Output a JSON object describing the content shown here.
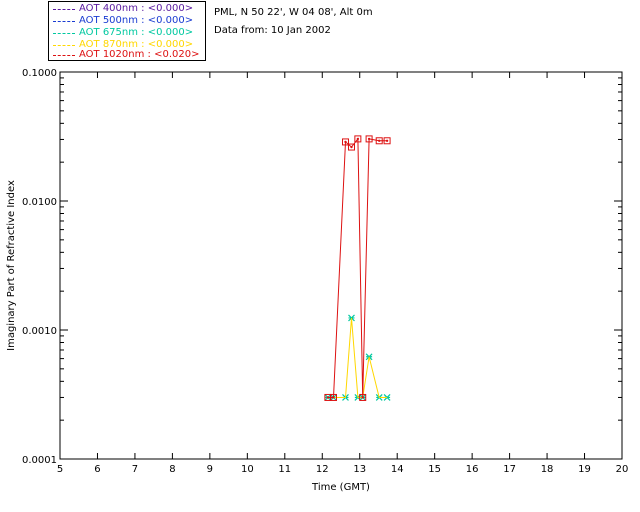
{
  "header": {
    "station": "PML, N 50 22', W 04 08', Alt 0m",
    "date": "Data from: 10 Jan 2002"
  },
  "legend": [
    {
      "label": "AOT  400nm : <0.000>",
      "color": "#5a1aa0"
    },
    {
      "label": "AOT  500nm : <0.000>",
      "color": "#1a3cd2"
    },
    {
      "label": "AOT  675nm : <0.000>",
      "color": "#00c8a0"
    },
    {
      "label": "AOT  870nm : <0.000>",
      "color": "#ffd700"
    },
    {
      "label": "AOT 1020nm : <0.020>",
      "color": "#dd1111"
    }
  ],
  "chart_data": {
    "type": "line",
    "xlabel": "Time (GMT)",
    "ylabel": "Imaginary Part of Refractive Index",
    "xlim": [
      5,
      20
    ],
    "ylim": [
      0.0001,
      0.1
    ],
    "yscale": "log",
    "xticks": [
      5,
      6,
      7,
      8,
      9,
      10,
      11,
      12,
      13,
      14,
      15,
      16,
      17,
      18,
      19,
      20
    ],
    "yticks": [
      {
        "value": 0.0001,
        "label": "0.0001"
      },
      {
        "value": 0.001,
        "label": "0.0010"
      },
      {
        "value": 0.01,
        "label": "0.0100"
      },
      {
        "value": 0.1,
        "label": "0.1000"
      }
    ],
    "series": [
      {
        "name": "AOT  400nm : <0.000>",
        "color": "#5a1aa0",
        "marker": "none",
        "x": [],
        "y": []
      },
      {
        "name": "AOT  500nm : <0.000>",
        "color": "#1a3cd2",
        "marker": "none",
        "x": [],
        "y": []
      },
      {
        "name": "AOT  675nm : <0.000>",
        "color": "#00c8a0",
        "marker": "x",
        "x": [
          12.15,
          12.3,
          12.62,
          12.78,
          12.95,
          13.08,
          13.25,
          13.52,
          13.73
        ],
        "y": [
          0.0003,
          0.0003,
          0.0003,
          0.00124,
          0.0003,
          0.0003,
          0.00062,
          0.0003,
          0.0003
        ]
      },
      {
        "name": "AOT  870nm : <0.000>",
        "color": "#ffd700",
        "marker": "none",
        "x": [
          12.15,
          12.3,
          12.62,
          12.78,
          12.95,
          13.08,
          13.25,
          13.52,
          13.73
        ],
        "y": [
          0.0003,
          0.0003,
          0.0003,
          0.00124,
          0.0003,
          0.0003,
          0.00062,
          0.0003,
          0.0003
        ]
      },
      {
        "name": "AOT 1020nm : <0.020>",
        "color": "#dd1111",
        "marker": "square",
        "x": [
          12.15,
          12.3,
          12.62,
          12.78,
          12.95,
          13.08,
          13.25,
          13.52,
          13.73
        ],
        "y": [
          0.0003,
          0.0003,
          0.0287,
          0.0262,
          0.0303,
          0.0003,
          0.0303,
          0.0293,
          0.0293
        ]
      }
    ]
  }
}
